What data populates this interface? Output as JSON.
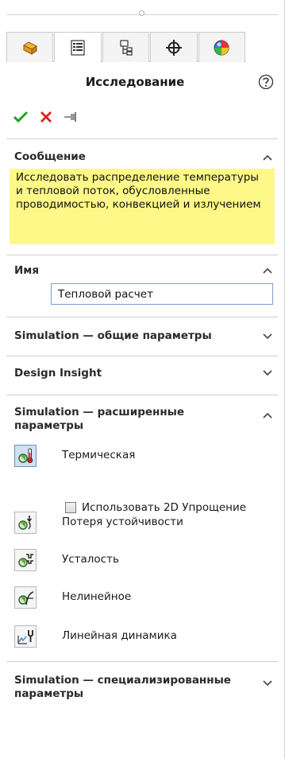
{
  "panel": {
    "title": "Исследование"
  },
  "tabs": [
    {
      "icon": "feature-manager-icon",
      "active": false
    },
    {
      "icon": "property-manager-icon",
      "active": true
    },
    {
      "icon": "configuration-manager-icon",
      "active": false
    },
    {
      "icon": "dimxpert-icon",
      "active": false
    },
    {
      "icon": "display-manager-icon",
      "active": false
    }
  ],
  "sections": {
    "message": {
      "title": "Сообщение",
      "text": "Исследовать распределение температуры и тепловой поток, обусловленные проводимостью, конвекцией и излучением"
    },
    "name": {
      "title": "Имя",
      "value": "Тепловой расчет"
    },
    "general": {
      "title": "Simulation — общие параметры"
    },
    "design_insight": {
      "title": "Design Insight"
    },
    "advanced": {
      "title": "Simulation — расширенные параметры",
      "items": [
        {
          "label": "Термическая",
          "icon": "thermal-study-icon",
          "selected": true
        },
        {
          "label": "Потеря устойчивости",
          "icon": "buckling-study-icon",
          "selected": false
        },
        {
          "label": "Усталость",
          "icon": "fatigue-study-icon",
          "selected": false
        },
        {
          "label": "Нелинейное",
          "icon": "nonlinear-study-icon",
          "selected": false
        },
        {
          "label": "Линейная динамика",
          "icon": "linear-dynamic-study-icon",
          "selected": false
        }
      ],
      "checkbox_label": "Использовать 2D Упрощение",
      "checkbox_checked": false
    },
    "specialized": {
      "title": "Simulation — специализированные параметры"
    }
  },
  "colors": {
    "message_bg": "#fdf888",
    "ok_green": "#1ea31e",
    "cancel_red": "#e02020",
    "input_border": "#7a9ccf",
    "selected_bg": "#cfe0f2"
  }
}
